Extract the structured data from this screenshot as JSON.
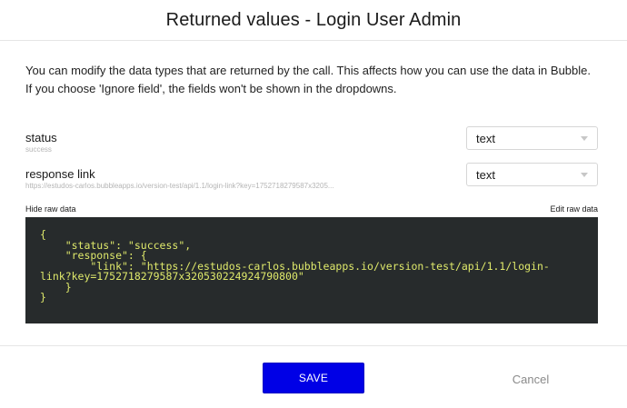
{
  "dialog": {
    "title": "Returned values - Login User Admin",
    "description": "You can modify the data types that are returned by the call. This affects how you can use the data in Bubble. If you choose 'Ignore field', the fields won't be shown in the dropdowns."
  },
  "fields": [
    {
      "label": "status",
      "sample": "success",
      "type": "text"
    },
    {
      "label": "response link",
      "sample": "https://estudos-carlos.bubbleapps.io/version-test/api/1.1/login-link?key=1752718279587x3205...",
      "type": "text"
    }
  ],
  "raw_data": {
    "hide_label": "Hide raw data",
    "edit_label": "Edit raw data",
    "json": "{\n    \"status\": \"success\",\n    \"response\": {\n        \"link\": \"https://estudos-carlos.bubbleapps.io/version-test/api/1.1/login-\nlink?key=1752718279587x320530224924790800\"\n    }\n}"
  },
  "footer": {
    "save_label": "SAVE",
    "cancel_label": "Cancel"
  },
  "colors": {
    "save_button": "#0000e6",
    "code_background": "#272b2c",
    "code_text": "#dfe96b"
  },
  "icons": {
    "select_arrow": "chevron-down-icon"
  }
}
